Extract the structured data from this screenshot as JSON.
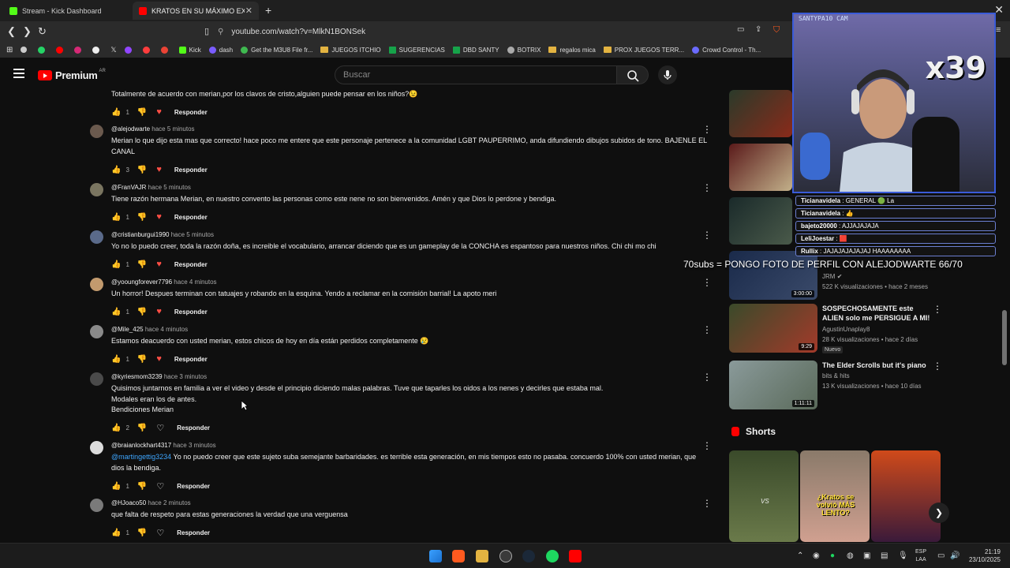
{
  "browser": {
    "tabs": [
      {
        "label": "Stream - Kick Dashboard"
      },
      {
        "label": "KRATOS EN SU MÁXIMO EXPLE..."
      }
    ],
    "url": "youtube.com/watch?v=MlkN1BONSek",
    "bookmarks": [
      {
        "label": "Kick",
        "color": "#53fc18"
      },
      {
        "label": "dash",
        "color": "#7a5cff"
      },
      {
        "label": "Get the M3U8 File fr...",
        "color": "#3fb950"
      },
      {
        "label": "JUEGOS ITCHIO",
        "folder": true
      },
      {
        "label": "SUGERENCIAS",
        "color": "#16a34a"
      },
      {
        "label": "DBD SANTY",
        "color": "#16a34a"
      },
      {
        "label": "BOTRIX",
        "color": "#aaaaaa"
      },
      {
        "label": "regalos mica",
        "folder": true
      },
      {
        "label": "PROX JUEGOS TERR...",
        "folder": true
      },
      {
        "label": "Crowd Control - Th...",
        "color": "#6b6bff"
      }
    ]
  },
  "youtube": {
    "logo_text": "Premium",
    "region": "AR",
    "search_placeholder": "Buscar"
  },
  "comments": [
    {
      "author": "",
      "time": "",
      "text": "Totalmente de acuerdo con merian,por los clavos de cristo,alguien puede pensar en los niños?😉",
      "likes": "1",
      "hearted": true,
      "reply": "Responder"
    },
    {
      "author": "@alejodwarte",
      "time": "hace 5 minutos",
      "text": "Merian lo que dijo esta mas que correcto! hace poco me entere que este personaje pertenece a la comunidad LGBT PAUPERRIMO, anda difundiendo dibujos subidos de tono. BAJENLE EL CANAL",
      "likes": "3",
      "hearted": true,
      "reply": "Responder"
    },
    {
      "author": "@FranVAJR",
      "time": "hace 5 minutos",
      "text": "Tiene razón hermana Merian, en nuestro convento las personas como este nene no son bienvenidos. Amén y que Dios lo perdone y bendiga.",
      "likes": "1",
      "hearted": true,
      "reply": "Responder"
    },
    {
      "author": "@cristianburgui1990",
      "time": "hace 5 minutos",
      "text": "Yo no lo puedo creer, toda la razón doña, es increible el vocabulario, arrancar diciendo que es un gameplay de la CONCHA es espantoso para nuestros niños. Chi chi mo chi",
      "likes": "1",
      "hearted": true,
      "reply": "Responder"
    },
    {
      "author": "@yooungforever7796",
      "time": "hace 4 minutos",
      "text": "Un horror! Despues terminan con tatuajes y robando en la esquina. Yendo a reclamar en la comisión barrial! La apoto meri",
      "likes": "1",
      "hearted": true,
      "reply": "Responder"
    },
    {
      "author": "@Mile_425",
      "time": "hace 4 minutos",
      "text": "Estamos deacuerdo con usted merian, estos chicos de hoy en día están perdidos completamente 😢",
      "likes": "1",
      "hearted": true,
      "reply": "Responder"
    },
    {
      "author": "@kyriesmom3239",
      "time": "hace 3 minutos",
      "text": "Quisimos juntarnos en familia a ver el video y desde el principio diciendo malas palabras. Tuve que taparles los oidos a los nenes y decirles que estaba mal.",
      "text2": "Modales eran los de antes.",
      "text3": "Bendiciones Merian",
      "likes": "2",
      "hearted": false,
      "reply": "Responder"
    },
    {
      "author": "@braianlockhart4317",
      "time": "hace 3 minutos",
      "mention": "@martingettig3234",
      "text": " Yo no puedo creer que este sujeto suba semejante barbaridades. es terrible esta generación, en mis tiempos esto no pasaba. concuerdo 100% con usted merian, que dios la bendiga.",
      "likes": "1",
      "hearted": false,
      "reply": "Responder"
    },
    {
      "author": "@HJoaco50",
      "time": "hace 2 minutos",
      "text": "que falta de respeto para estas generaciones la verdad que una verguensa",
      "likes": "1",
      "hearted": false,
      "reply": "Responder"
    }
  ],
  "recommendations": [
    {
      "title": "",
      "channel": "JRM",
      "meta": "522 K visualizaciones • hace 2 meses",
      "duration": "3:00:00",
      "thumb_color": "#1a2a4a"
    },
    {
      "title": "SOSPECHOSAMENTE este ALIEN solo me PERSIGUE A MI!",
      "channel": "AgustinUnaplay8",
      "meta": "28 K visualizaciones • hace 2 días",
      "badge": "Nuevo",
      "duration": "9:29",
      "thumb_color": "#3a4a2a"
    },
    {
      "title": "The Elder Scrolls but it's piano",
      "channel": "bits & hits",
      "meta": "13 K visualizaciones • hace 10 días",
      "duration": "1:11:11",
      "thumb_color": "#6a7a8a"
    }
  ],
  "shorts": {
    "title": "Shorts",
    "items": [
      {
        "label": "VS",
        "color": "#3a4a2a"
      },
      {
        "label": "¿Kratos se volvió MÁS LENTO?",
        "color": "#b89080"
      },
      {
        "label": "",
        "color": "#7a2a1a"
      }
    ]
  },
  "stream_overlay": {
    "cam_label": "SANTYPA10 CAM",
    "multiplier": "x39",
    "chat": [
      {
        "user": "Ticianavidela",
        "msg": ": GENERAL 🟢 La"
      },
      {
        "user": "Ticianavidela",
        "msg": ": 👍"
      },
      {
        "user": "bajeto20000",
        "msg": ": AJJAJAJAJA"
      },
      {
        "user": "LeliJoestar",
        "msg": ": 🟥"
      },
      {
        "user": "Rullix",
        "msg": ": JAJAJAJAJAJAJ HAAAAAAAA"
      }
    ],
    "subs_goal": "70subs = PONGO FOTO DE PERFIL CON ALEJODWARTE  66/70"
  },
  "taskbar": {
    "lang": "ESP",
    "lang2": "LAA",
    "time": "21:19",
    "date": "23/10/2025"
  }
}
